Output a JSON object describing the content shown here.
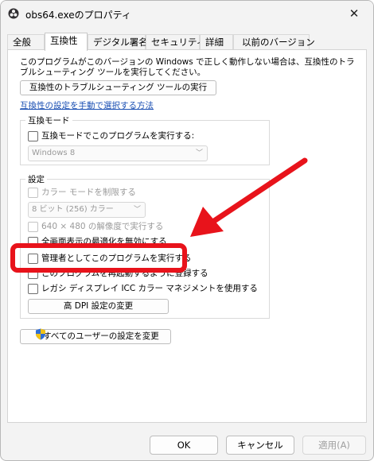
{
  "window": {
    "title": "obs64.exeのプロパティ",
    "close_glyph": "✕"
  },
  "tabs": [
    {
      "label": "全般"
    },
    {
      "label": "互換性"
    },
    {
      "label": "デジタル署名"
    },
    {
      "label": "セキュリティ"
    },
    {
      "label": "詳細"
    },
    {
      "label": "以前のバージョン"
    }
  ],
  "compat": {
    "description": "このプログラムがこのバージョンの Windows で正しく動作しない場合は、互換性のトラブルシューティング ツールを実行してください。",
    "troubleshoot_button": "互換性のトラブルシューティング ツールの実行",
    "manual_link": "互換性の設定を手動で選択する方法"
  },
  "compat_mode": {
    "group_label": "互換モード",
    "checkbox_label": "互換モードでこのプログラムを実行する:",
    "select_value": "Windows 8"
  },
  "settings": {
    "group_label": "設定",
    "reduced_color_label": "カラー モードを制限する",
    "color_select_value": "8 ビット (256) カラー",
    "res_640_label": "640 × 480 の解像度で実行する",
    "fullscreen_label": "全画面表示の最適化を無効にする",
    "admin_label": "管理者としてこのプログラムを実行する",
    "restart_label": "このプログラムを再起動するように登録する",
    "icc_label": "レガシ ディスプレイ ICC カラー マネジメントを使用する",
    "dpi_button": "高 DPI 設定の変更"
  },
  "all_users_button": "すべてのユーザーの設定を変更",
  "footer": {
    "ok": "OK",
    "cancel": "キャンセル",
    "apply": "適用(A)"
  },
  "colors": {
    "highlight": "#e8131b",
    "link": "#1a4fb3"
  },
  "icons": [
    "obs-app-icon",
    "close-icon",
    "chevron-down-icon",
    "uac-shield-icon",
    "red-arrow-annotation"
  ]
}
